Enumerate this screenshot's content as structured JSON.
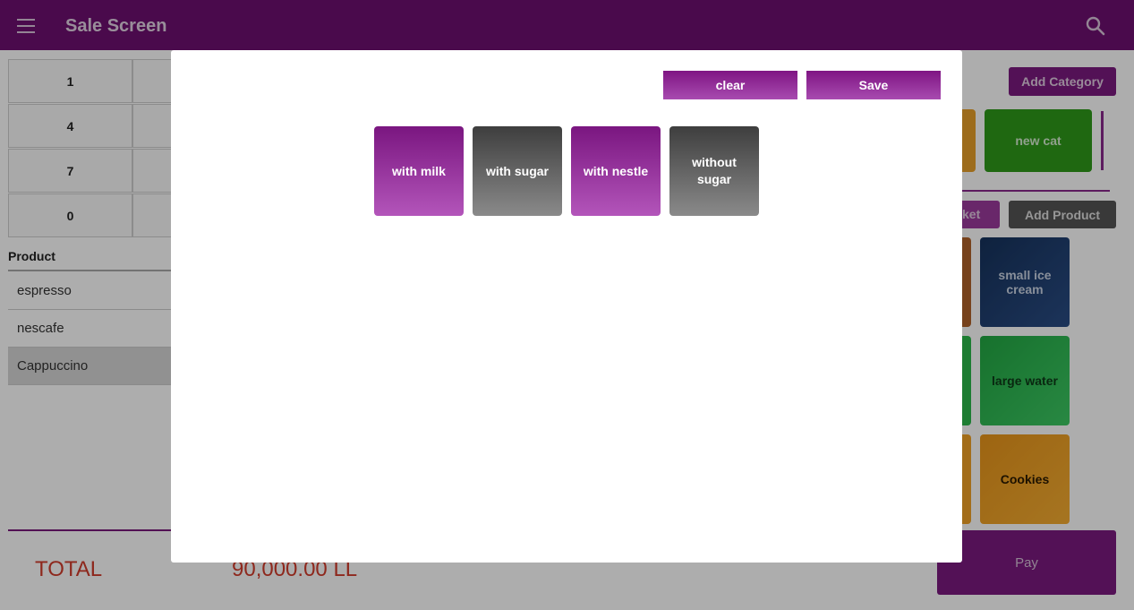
{
  "appbar": {
    "title": "Sale Screen",
    "menu_icon": "hamburger-menu-icon",
    "search_icon": "search-icon"
  },
  "keypad": {
    "keys": [
      "1",
      "4",
      "7",
      "0"
    ]
  },
  "products": {
    "header": "Product",
    "rows": [
      {
        "name": "espresso",
        "selected": false
      },
      {
        "name": "nescafe",
        "selected": false
      },
      {
        "name": "Cappuccino",
        "selected": true
      }
    ]
  },
  "totals": {
    "label": "TOTAL",
    "value": "90,000.00 LL"
  },
  "categories": {
    "add_label": "Add Category",
    "items": [
      {
        "name": "new cat",
        "color": "#2e9a1a"
      }
    ]
  },
  "product_bar": {
    "basket_partial": "ket",
    "add_label": "Add Product"
  },
  "product_tiles": [
    {
      "name": "small ice cream",
      "color": "#1e3a6a",
      "text_color": "#c9d3e3"
    },
    {
      "name": "large water",
      "color": "#2bb84a",
      "text_color": "#0e3a18"
    },
    {
      "name": "Cookies",
      "color": "#f0a125",
      "text_color": "#2a1a00"
    }
  ],
  "pay": {
    "label": "Pay"
  },
  "modal": {
    "clear_label": "clear",
    "save_label": "Save",
    "options": [
      {
        "label": "with milk",
        "selected": true
      },
      {
        "label": "with sugar",
        "selected": false
      },
      {
        "label": "with nestle",
        "selected": true
      },
      {
        "label": "without sugar",
        "selected": false
      }
    ]
  },
  "colors": {
    "brand": "#6e0f70",
    "total": "#d23c2c"
  }
}
